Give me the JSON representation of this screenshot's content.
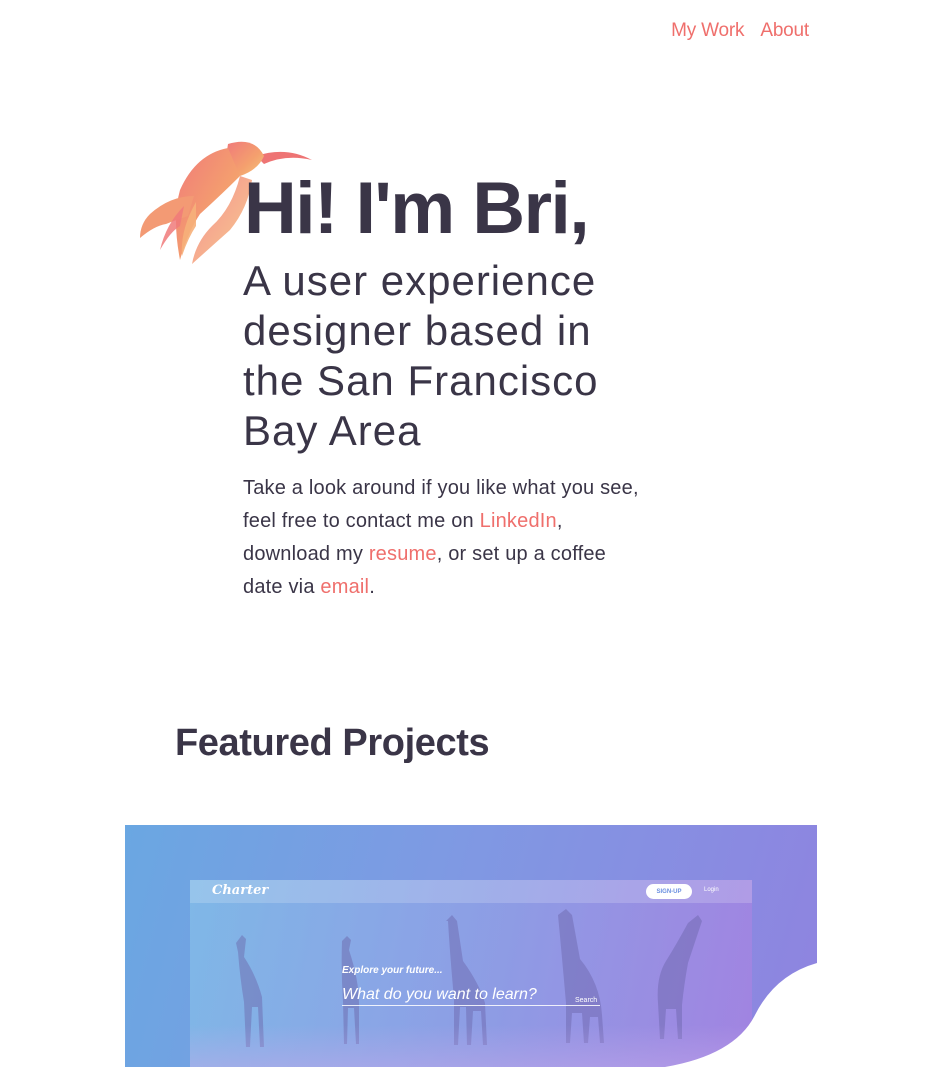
{
  "nav": {
    "my_work": "My Work",
    "about": "About"
  },
  "hero": {
    "title": "Hi! I'm Bri,",
    "subtitle": "A user experience designer based in the San Francisco Bay Area",
    "body_1": "Take a look around if you like what you see, feel free to contact me on ",
    "linkedin": "LinkedIn",
    "body_2": ", download my ",
    "resume": "resume",
    "body_3": ", or set up a coffee date via ",
    "email": "email",
    "body_4": "."
  },
  "featured": {
    "title": "Featured Projects",
    "project": {
      "logo": "Charter",
      "signup": "SIGN-UP",
      "login": "Login",
      "hint": "Explore your future...",
      "search_placeholder": "What do you want to learn?",
      "search_button": "Search"
    }
  },
  "colors": {
    "accent": "#ef6f6c",
    "text": "#3a3547",
    "card_gradient_start": "#6aa7e2",
    "card_gradient_end": "#8f83e0"
  },
  "icons": {
    "logo": "hummingbird-icon"
  }
}
